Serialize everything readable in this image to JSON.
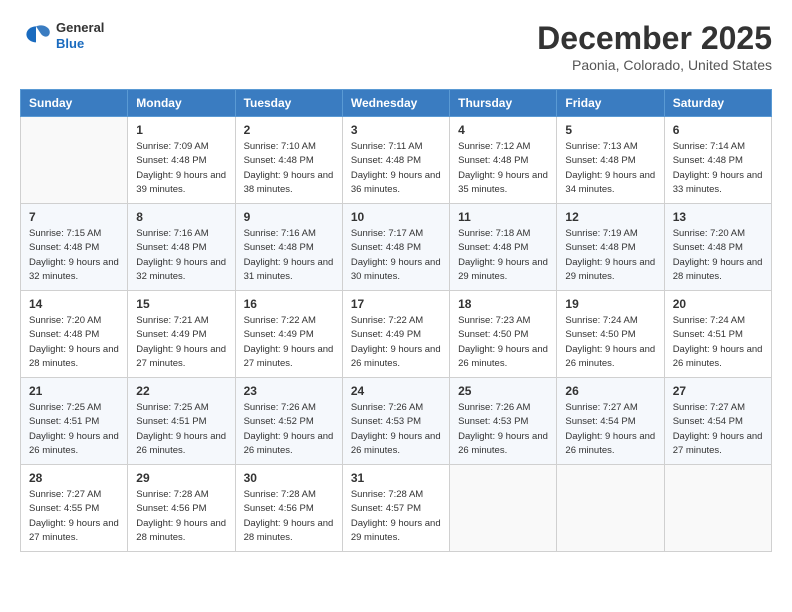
{
  "header": {
    "logo": {
      "general": "General",
      "blue": "Blue"
    },
    "title": "December 2025",
    "location": "Paonia, Colorado, United States"
  },
  "calendar": {
    "days_of_week": [
      "Sunday",
      "Monday",
      "Tuesday",
      "Wednesday",
      "Thursday",
      "Friday",
      "Saturday"
    ],
    "weeks": [
      [
        {
          "day": "",
          "sunrise": "",
          "sunset": "",
          "daylight": ""
        },
        {
          "day": "1",
          "sunrise": "Sunrise: 7:09 AM",
          "sunset": "Sunset: 4:48 PM",
          "daylight": "Daylight: 9 hours and 39 minutes."
        },
        {
          "day": "2",
          "sunrise": "Sunrise: 7:10 AM",
          "sunset": "Sunset: 4:48 PM",
          "daylight": "Daylight: 9 hours and 38 minutes."
        },
        {
          "day": "3",
          "sunrise": "Sunrise: 7:11 AM",
          "sunset": "Sunset: 4:48 PM",
          "daylight": "Daylight: 9 hours and 36 minutes."
        },
        {
          "day": "4",
          "sunrise": "Sunrise: 7:12 AM",
          "sunset": "Sunset: 4:48 PM",
          "daylight": "Daylight: 9 hours and 35 minutes."
        },
        {
          "day": "5",
          "sunrise": "Sunrise: 7:13 AM",
          "sunset": "Sunset: 4:48 PM",
          "daylight": "Daylight: 9 hours and 34 minutes."
        },
        {
          "day": "6",
          "sunrise": "Sunrise: 7:14 AM",
          "sunset": "Sunset: 4:48 PM",
          "daylight": "Daylight: 9 hours and 33 minutes."
        }
      ],
      [
        {
          "day": "7",
          "sunrise": "Sunrise: 7:15 AM",
          "sunset": "Sunset: 4:48 PM",
          "daylight": "Daylight: 9 hours and 32 minutes."
        },
        {
          "day": "8",
          "sunrise": "Sunrise: 7:16 AM",
          "sunset": "Sunset: 4:48 PM",
          "daylight": "Daylight: 9 hours and 32 minutes."
        },
        {
          "day": "9",
          "sunrise": "Sunrise: 7:16 AM",
          "sunset": "Sunset: 4:48 PM",
          "daylight": "Daylight: 9 hours and 31 minutes."
        },
        {
          "day": "10",
          "sunrise": "Sunrise: 7:17 AM",
          "sunset": "Sunset: 4:48 PM",
          "daylight": "Daylight: 9 hours and 30 minutes."
        },
        {
          "day": "11",
          "sunrise": "Sunrise: 7:18 AM",
          "sunset": "Sunset: 4:48 PM",
          "daylight": "Daylight: 9 hours and 29 minutes."
        },
        {
          "day": "12",
          "sunrise": "Sunrise: 7:19 AM",
          "sunset": "Sunset: 4:48 PM",
          "daylight": "Daylight: 9 hours and 29 minutes."
        },
        {
          "day": "13",
          "sunrise": "Sunrise: 7:20 AM",
          "sunset": "Sunset: 4:48 PM",
          "daylight": "Daylight: 9 hours and 28 minutes."
        }
      ],
      [
        {
          "day": "14",
          "sunrise": "Sunrise: 7:20 AM",
          "sunset": "Sunset: 4:48 PM",
          "daylight": "Daylight: 9 hours and 28 minutes."
        },
        {
          "day": "15",
          "sunrise": "Sunrise: 7:21 AM",
          "sunset": "Sunset: 4:49 PM",
          "daylight": "Daylight: 9 hours and 27 minutes."
        },
        {
          "day": "16",
          "sunrise": "Sunrise: 7:22 AM",
          "sunset": "Sunset: 4:49 PM",
          "daylight": "Daylight: 9 hours and 27 minutes."
        },
        {
          "day": "17",
          "sunrise": "Sunrise: 7:22 AM",
          "sunset": "Sunset: 4:49 PM",
          "daylight": "Daylight: 9 hours and 26 minutes."
        },
        {
          "day": "18",
          "sunrise": "Sunrise: 7:23 AM",
          "sunset": "Sunset: 4:50 PM",
          "daylight": "Daylight: 9 hours and 26 minutes."
        },
        {
          "day": "19",
          "sunrise": "Sunrise: 7:24 AM",
          "sunset": "Sunset: 4:50 PM",
          "daylight": "Daylight: 9 hours and 26 minutes."
        },
        {
          "day": "20",
          "sunrise": "Sunrise: 7:24 AM",
          "sunset": "Sunset: 4:51 PM",
          "daylight": "Daylight: 9 hours and 26 minutes."
        }
      ],
      [
        {
          "day": "21",
          "sunrise": "Sunrise: 7:25 AM",
          "sunset": "Sunset: 4:51 PM",
          "daylight": "Daylight: 9 hours and 26 minutes."
        },
        {
          "day": "22",
          "sunrise": "Sunrise: 7:25 AM",
          "sunset": "Sunset: 4:51 PM",
          "daylight": "Daylight: 9 hours and 26 minutes."
        },
        {
          "day": "23",
          "sunrise": "Sunrise: 7:26 AM",
          "sunset": "Sunset: 4:52 PM",
          "daylight": "Daylight: 9 hours and 26 minutes."
        },
        {
          "day": "24",
          "sunrise": "Sunrise: 7:26 AM",
          "sunset": "Sunset: 4:53 PM",
          "daylight": "Daylight: 9 hours and 26 minutes."
        },
        {
          "day": "25",
          "sunrise": "Sunrise: 7:26 AM",
          "sunset": "Sunset: 4:53 PM",
          "daylight": "Daylight: 9 hours and 26 minutes."
        },
        {
          "day": "26",
          "sunrise": "Sunrise: 7:27 AM",
          "sunset": "Sunset: 4:54 PM",
          "daylight": "Daylight: 9 hours and 26 minutes."
        },
        {
          "day": "27",
          "sunrise": "Sunrise: 7:27 AM",
          "sunset": "Sunset: 4:54 PM",
          "daylight": "Daylight: 9 hours and 27 minutes."
        }
      ],
      [
        {
          "day": "28",
          "sunrise": "Sunrise: 7:27 AM",
          "sunset": "Sunset: 4:55 PM",
          "daylight": "Daylight: 9 hours and 27 minutes."
        },
        {
          "day": "29",
          "sunrise": "Sunrise: 7:28 AM",
          "sunset": "Sunset: 4:56 PM",
          "daylight": "Daylight: 9 hours and 28 minutes."
        },
        {
          "day": "30",
          "sunrise": "Sunrise: 7:28 AM",
          "sunset": "Sunset: 4:56 PM",
          "daylight": "Daylight: 9 hours and 28 minutes."
        },
        {
          "day": "31",
          "sunrise": "Sunrise: 7:28 AM",
          "sunset": "Sunset: 4:57 PM",
          "daylight": "Daylight: 9 hours and 29 minutes."
        },
        {
          "day": "",
          "sunrise": "",
          "sunset": "",
          "daylight": ""
        },
        {
          "day": "",
          "sunrise": "",
          "sunset": "",
          "daylight": ""
        },
        {
          "day": "",
          "sunrise": "",
          "sunset": "",
          "daylight": ""
        }
      ]
    ]
  }
}
